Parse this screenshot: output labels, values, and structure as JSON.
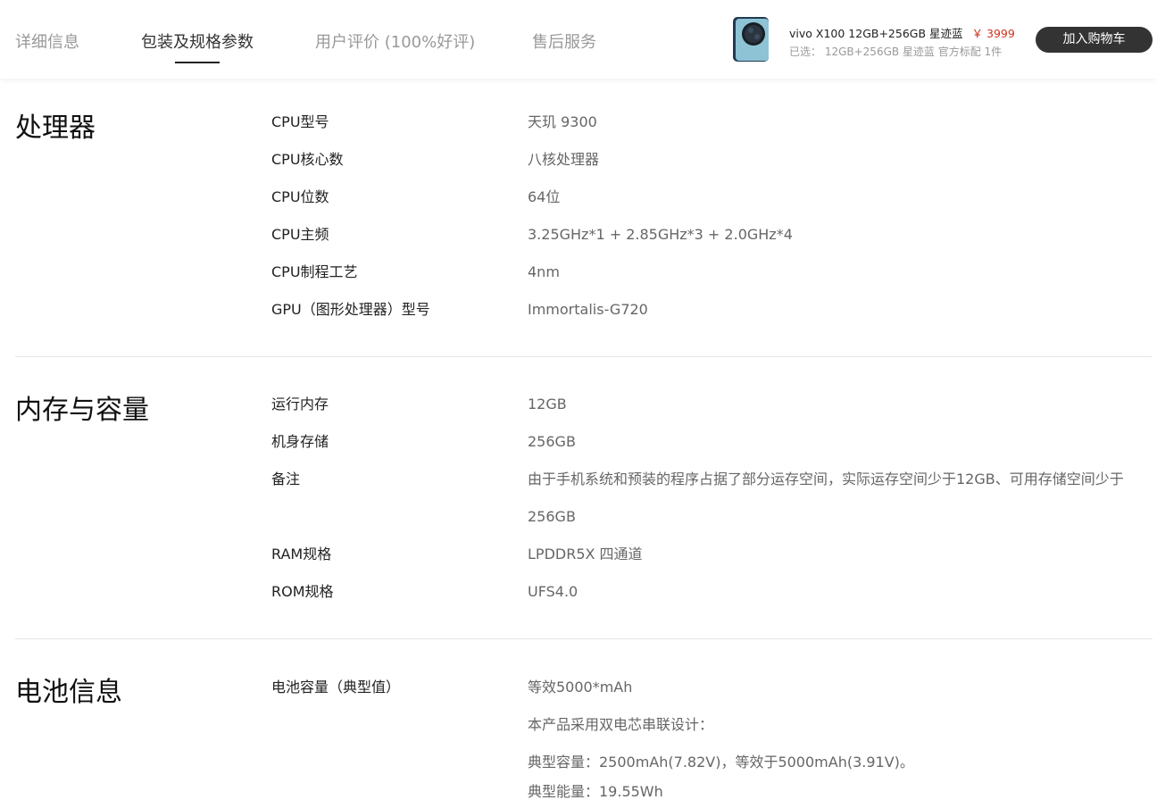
{
  "tabs": [
    {
      "label": "详细信息"
    },
    {
      "label": "包装及规格参数"
    },
    {
      "label": "用户评价 (100%好评)"
    },
    {
      "label": "售后服务"
    }
  ],
  "product": {
    "name": "vivo X100 12GB+256GB 星迹蓝",
    "price": "￥ 3999",
    "selected": "已选： 12GB+256GB 星迹蓝 官方标配 1件",
    "cart_button": "加入购物车"
  },
  "sections": [
    {
      "title": "处理器",
      "rows": [
        {
          "key": "CPU型号",
          "value": "天玑 9300"
        },
        {
          "key": "CPU核心数",
          "value": "八核处理器"
        },
        {
          "key": "CPU位数",
          "value": "64位"
        },
        {
          "key": "CPU主频",
          "value": "3.25GHz*1 + 2.85GHz*3 + 2.0GHz*4"
        },
        {
          "key": "CPU制程工艺",
          "value": "4nm"
        },
        {
          "key": "GPU（图形处理器）型号",
          "value": "Immortalis-G720"
        }
      ]
    },
    {
      "title": "内存与容量",
      "rows": [
        {
          "key": "运行内存",
          "value": "12GB"
        },
        {
          "key": "机身存储",
          "value": "256GB"
        },
        {
          "key": "备注",
          "value": "由于手机系统和预装的程序占据了部分运存空间，实际运存空间少于12GB、可用存储空间少于256GB"
        },
        {
          "key": "RAM规格",
          "value": "LPDDR5X 四通道"
        },
        {
          "key": "ROM规格",
          "value": "UFS4.0"
        }
      ]
    },
    {
      "title": "电池信息",
      "rows": [
        {
          "key": "电池容量（典型值）",
          "value": "等效5000*mAh"
        },
        {
          "key": "",
          "value": "本产品采用双电芯串联设计："
        },
        {
          "key": "",
          "value": "典型容量：2500mAh(7.82V)，等效于5000mAh(3.91V)。"
        },
        {
          "key": "",
          "value": "典型能量：19.55Wh"
        }
      ]
    }
  ]
}
